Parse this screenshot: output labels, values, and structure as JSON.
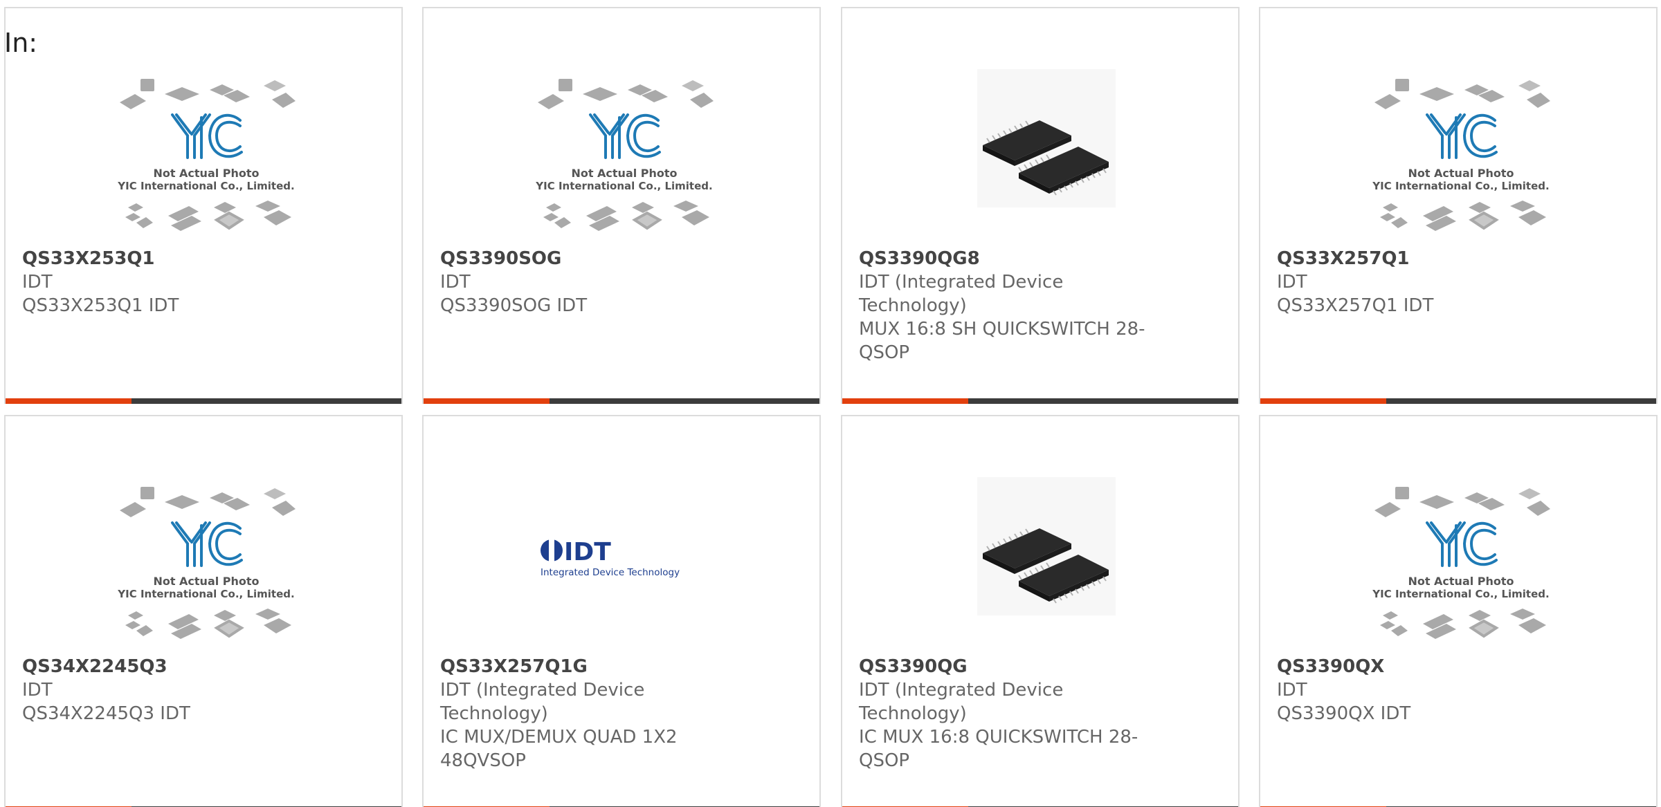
{
  "header": {
    "in_label": "In:"
  },
  "colors": {
    "accent": "#e2400e",
    "bar": "#3c3c3c",
    "yic_blue": "#1e7ab5"
  },
  "placeholder": {
    "line1": "Not Actual Photo",
    "line2": "YIC International Co., Limited."
  },
  "idt_logo": {
    "word": "IDT",
    "tagline": "Integrated Device Technology"
  },
  "products": [
    {
      "part": "QS33X253Q1",
      "maker": "IDT",
      "desc": "QS33X253Q1 IDT",
      "image": "yic-placeholder-photo"
    },
    {
      "part": "QS3390SOG",
      "maker": "IDT",
      "desc": "QS3390SOG IDT",
      "image": "yic-placeholder-photo"
    },
    {
      "part": "QS3390QG8",
      "maker": "IDT (Integrated Device Technology)",
      "desc": "MUX 16:8 SH QUICKSWITCH 28-QSOP",
      "image": "chip-photo"
    },
    {
      "part": "QS33X257Q1",
      "maker": "IDT",
      "desc": "QS33X257Q1 IDT",
      "image": "yic-placeholder-photo"
    },
    {
      "part": "QS34X2245Q3",
      "maker": "IDT",
      "desc": "QS34X2245Q3 IDT",
      "image": "yic-placeholder-photo"
    },
    {
      "part": "QS33X257Q1G",
      "maker": "IDT (Integrated Device Technology)",
      "desc": "IC MUX/DEMUX QUAD 1X2 48QVSOP",
      "image": "idt-logo"
    },
    {
      "part": "QS3390QG",
      "maker": "IDT (Integrated Device Technology)",
      "desc": "IC MUX 16:8 QUICKSWITCH 28-QSOP",
      "image": "chip-photo"
    },
    {
      "part": "QS3390QX",
      "maker": "IDT",
      "desc": "QS3390QX IDT",
      "image": "yic-placeholder-photo"
    }
  ]
}
